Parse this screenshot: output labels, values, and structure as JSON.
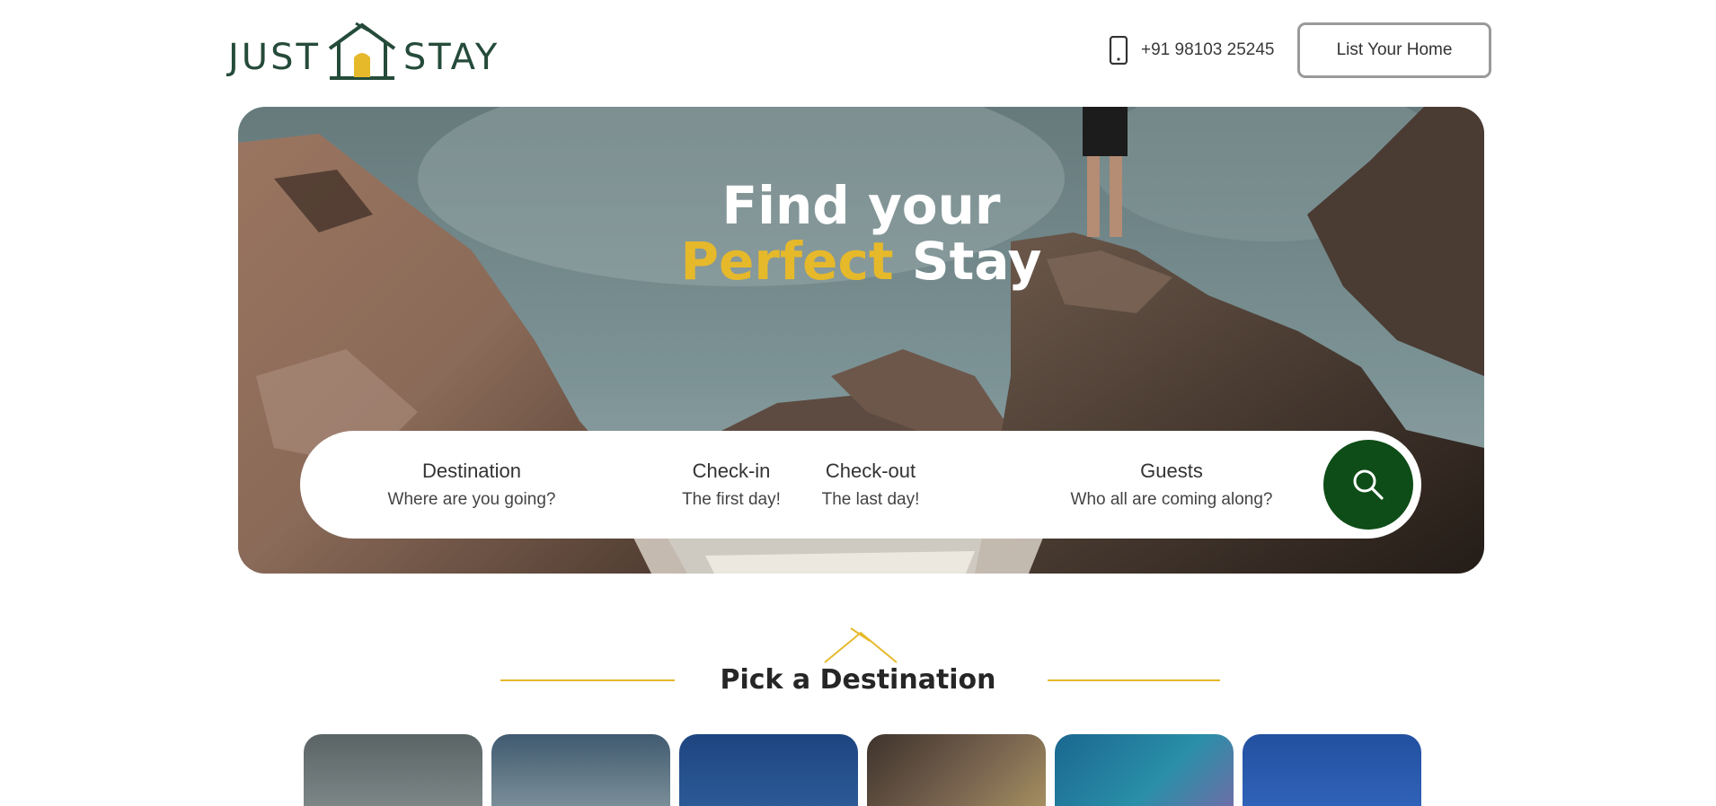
{
  "header": {
    "logo_left": "JUST",
    "logo_right": "STAY",
    "phone_icon": "phone-icon",
    "phone": "+91 98103 25245",
    "list_home_label": "List Your Home"
  },
  "hero": {
    "title_line1": "Find your",
    "title_accent": "Perfect",
    "title_rest": "Stay",
    "accent_color": "#e6b92b"
  },
  "search": {
    "destination_label": "Destination",
    "destination_hint": "Where are you going?",
    "checkin_label": "Check-in",
    "checkin_hint": "The first day!",
    "checkout_label": "Check-out",
    "checkout_hint": "The last day!",
    "guests_label": "Guests",
    "guests_hint": "Who all are coming along?",
    "search_icon": "search-icon",
    "button_color": "#0e4d17"
  },
  "section": {
    "title": "Pick a Destination",
    "line_color": "#e6b92b"
  },
  "destinations": [
    {
      "name": "",
      "color": "#5f6a6c"
    },
    {
      "name": "",
      "color": "#4f6a80"
    },
    {
      "name": "",
      "color": "#1f4a85"
    },
    {
      "name": "",
      "color": "#4e4035"
    },
    {
      "name": "",
      "color": "#1e6f90"
    },
    {
      "name": "",
      "color": "#2655a6"
    }
  ]
}
